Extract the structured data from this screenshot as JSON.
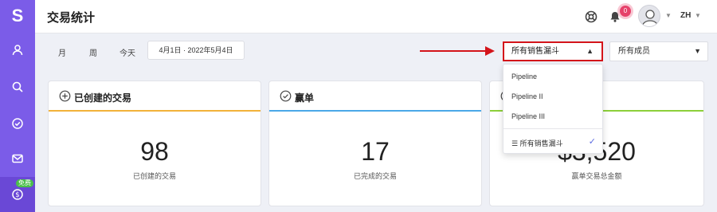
{
  "sidebar": {
    "logo": "S",
    "free_badge": "免费",
    "items": [
      {
        "icon": "user-icon"
      },
      {
        "icon": "search-icon"
      },
      {
        "icon": "check-circle-icon"
      },
      {
        "icon": "mail-icon"
      },
      {
        "icon": "dollar-icon"
      }
    ],
    "accent": "#7b5ce8"
  },
  "header": {
    "title": "交易统计",
    "notification_count": "0",
    "language": "ZH"
  },
  "filters": {
    "periods": [
      "月",
      "周",
      "今天"
    ],
    "date_range": "4月1日 · 2022年5月4日",
    "pipeline_select": "所有销售漏斗",
    "member_select": "所有成员"
  },
  "dropdown": {
    "options": [
      "Pipeline",
      "Pipeline II",
      "Pipeline III"
    ],
    "all_option": "所有销售漏斗"
  },
  "cards": [
    {
      "title": "已创建的交易",
      "value": "98",
      "label": "已创建的交易",
      "color": "#f2b23a"
    },
    {
      "title": "赢单",
      "value": "17",
      "label": "已完成的交易",
      "color": "#4aa8e8"
    },
    {
      "title": "",
      "value": "$3,520",
      "label": "赢单交易总金额",
      "color": "#8ccf3a"
    }
  ]
}
